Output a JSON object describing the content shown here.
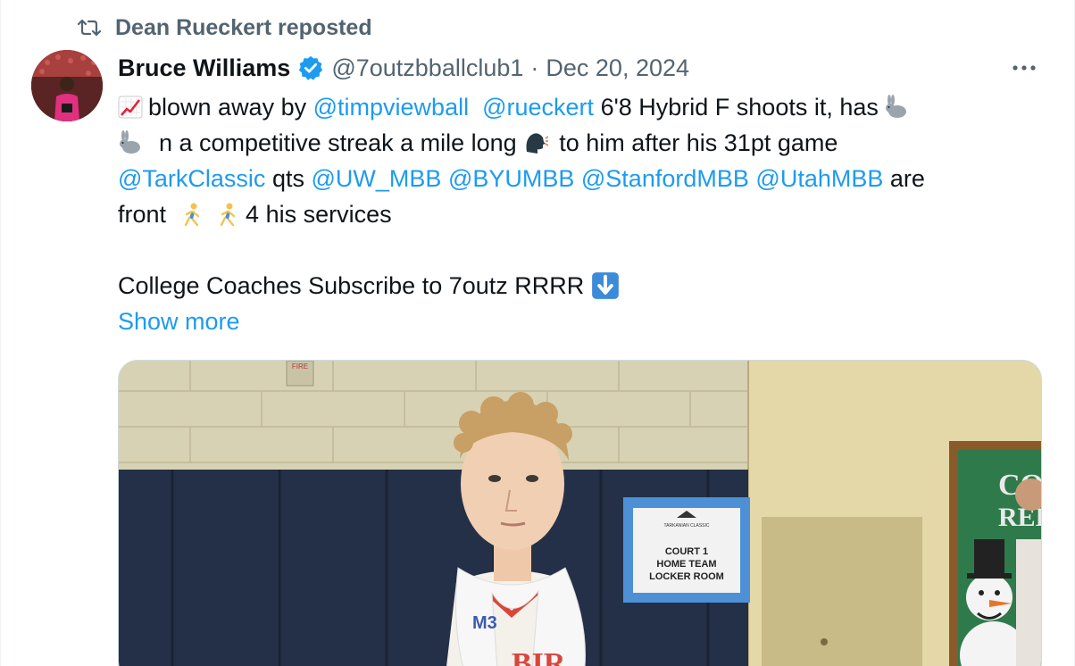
{
  "repost": {
    "text": "Dean Rueckert reposted"
  },
  "author": {
    "name": "Bruce Williams",
    "handle": "@7outzbballclub1",
    "separator": "·",
    "date": "Dec 20, 2024"
  },
  "body": {
    "line1": {
      "a": "blown away by",
      "m1": "@timpviewball",
      "m2": "@rueckert",
      "b": "6'8 Hybrid F shoots it, has"
    },
    "line2": {
      "a": "n a competitive streak a mile long",
      "b": "to him after his 31pt game"
    },
    "line3": {
      "m1": "@TarkClassic",
      "a": "qts",
      "m2": "@UW_MBB",
      "m3": "@BYUMBB",
      "m4": "@StanfordMBB",
      "m5": "@UtahMBB",
      "b": "are"
    },
    "line4": {
      "a": "front",
      "b": "4 his services"
    },
    "line5": {
      "a": "College Coaches Subscribe to 7outz RRRR"
    },
    "show_more": "Show more"
  },
  "photo": {
    "sign_fire": "FIRE",
    "sign_line1": "COURT 1",
    "sign_line2": "HOME TEAM",
    "sign_line3": "LOCKER ROOM",
    "sign_logo": "TARKANIAN CLASSIC",
    "poster_text1": "CO",
    "poster_text2": "REE",
    "jersey_text": "BIR",
    "towel_text": "M3"
  },
  "colors": {
    "link": "#1d9bf0",
    "secondary": "#536471",
    "text": "#0f1419",
    "verified": "#1d9bf0"
  },
  "icons": [
    "repost-icon",
    "verified-badge-icon",
    "more-icon",
    "chart-increasing-emoji",
    "rabbit-emoji",
    "speaking-head-emoji",
    "running-person-emoji",
    "down-arrow-emoji"
  ]
}
